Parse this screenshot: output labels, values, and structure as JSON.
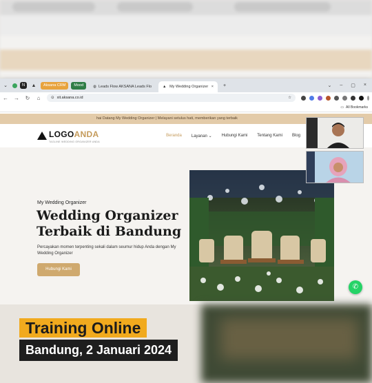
{
  "browser": {
    "chips": [
      "Aksana CRM",
      "Mood"
    ],
    "tabs": [
      "Leads Flow AKSANA Leads Flo",
      "My Wedding Organizer"
    ],
    "url": "xit.aksana.co.id",
    "bookmarks_label": "All Bookmarks"
  },
  "site": {
    "announcement": "hai Datang My Wedding Organizer | Melayani setulus hati, memberikan yang terbaik",
    "logo": {
      "part1": "LOGO",
      "part2": "ANDA",
      "tagline": "TAGLINE WEDDING ORGANIZER ANDA"
    },
    "menu": [
      "Beranda",
      "Layanan",
      "Hubungi Kami",
      "Tentang Kami",
      "Blog"
    ],
    "hero": {
      "eyebrow": "My Wedding Organizer",
      "title_line1": "Wedding Organizer",
      "title_line2": "Terbaik di Bandung",
      "subtitle": "Percayakan momen terpenting sekali dalam seumur hidup Anda dengan My Wedding Organizer",
      "cta": "Hubungi Kami"
    }
  },
  "caption": {
    "line1": "Training Online",
    "line2": "Bandung, 2 Januari 2024"
  },
  "colors": {
    "accent": "#cfa96e",
    "announce_bg": "#e3cba9",
    "caption_yellow": "#f1aa1e",
    "caption_dark": "#1e1e1e",
    "whatsapp": "#25d366"
  },
  "icons": [
    "back-icon",
    "forward-icon",
    "reload-icon",
    "home-icon",
    "star-icon",
    "whatsapp-icon",
    "bookmarks-folder-icon"
  ]
}
